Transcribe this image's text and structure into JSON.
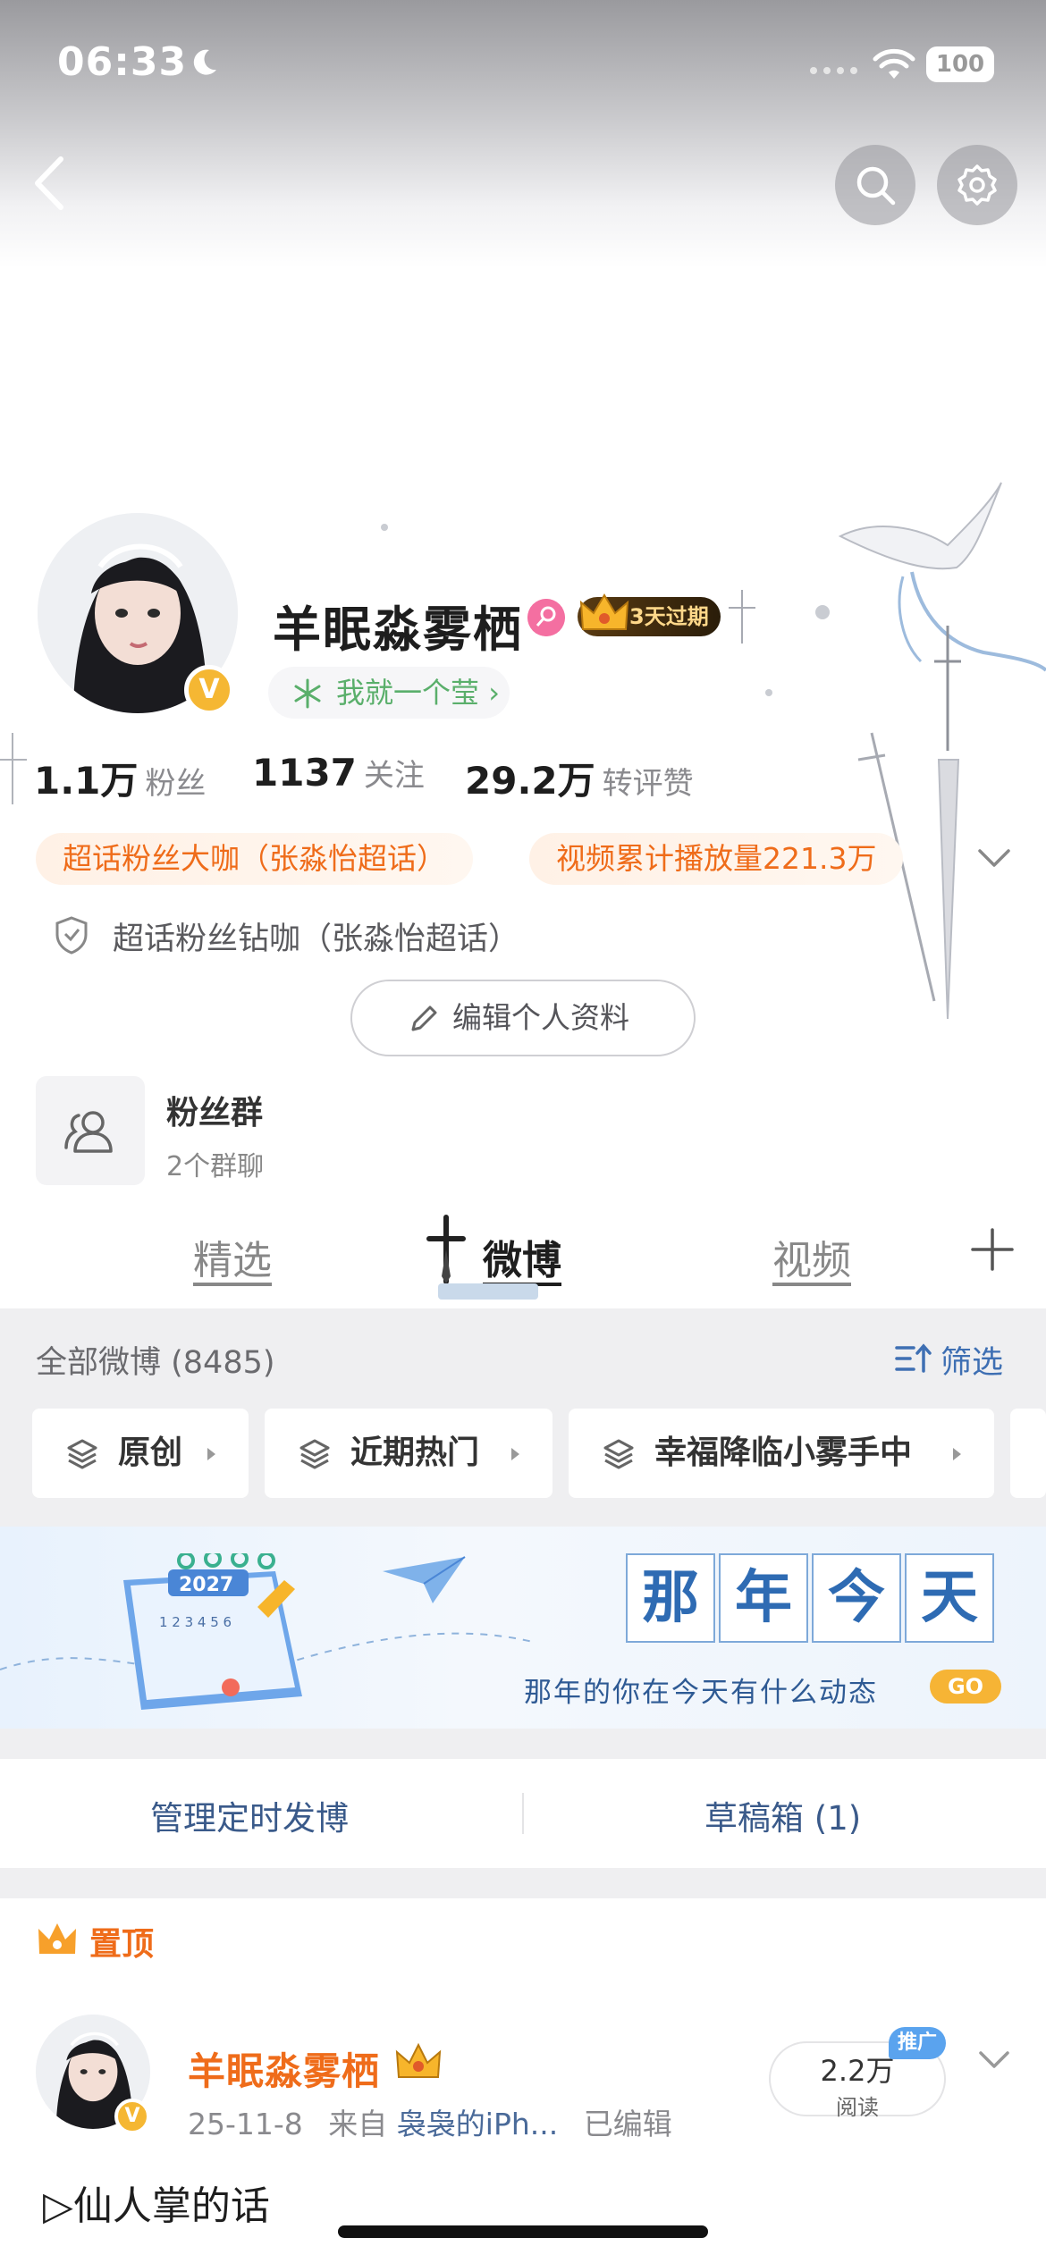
{
  "status_bar": {
    "time": "06:33",
    "battery": "100"
  },
  "profile": {
    "username": "羊眠淼雾栖",
    "vip_badge": "3天过期",
    "fanclub": "我就一个莹",
    "fanclub_suffix": "›",
    "stats": [
      {
        "value": "1.1万",
        "label": "粉丝"
      },
      {
        "value": "1137",
        "label": "关注"
      },
      {
        "value": "29.2万",
        "label": "转评赞"
      }
    ],
    "tags": [
      "超话粉丝大咖（张淼怡超话）",
      "视频累计播放量221.3万"
    ],
    "badge_text": "超话粉丝钻咖（张淼怡超话）",
    "edit_button": "编辑个人资料"
  },
  "fan_group": {
    "title": "粉丝群",
    "subtitle": "2个群聊"
  },
  "tabs": [
    "精选",
    "微博",
    "视频"
  ],
  "feed_header": {
    "all_label": "全部微博 (8485)",
    "filter_label": "筛选"
  },
  "chips": [
    "原创",
    "近期热门",
    "幸福降临小雾手中"
  ],
  "banner": {
    "chars": [
      "那",
      "年",
      "今",
      "天"
    ],
    "subtitle": "那年的你在今天有什么动态",
    "go": "GO",
    "calendar_year": "2027",
    "calendar_dates": "1 2 3 4 5 6"
  },
  "manage": {
    "scheduled": "管理定时发博",
    "drafts": "草稿箱 (1)"
  },
  "post": {
    "pinned_label": "置顶",
    "author": "羊眠淼雾栖",
    "date": "25-11-8",
    "from_prefix": "来自",
    "source": "袅袅的iPh...",
    "edited": "已编辑",
    "reads_value": "2.2万",
    "reads_label": "阅读",
    "promo": "推广",
    "text": "▷仙人掌的话"
  },
  "colors": {
    "accent_orange": "#ef6c1a",
    "link_blue": "#3e6fb3",
    "verified_gold": "#f5b733",
    "green": "#5aaf6b"
  }
}
